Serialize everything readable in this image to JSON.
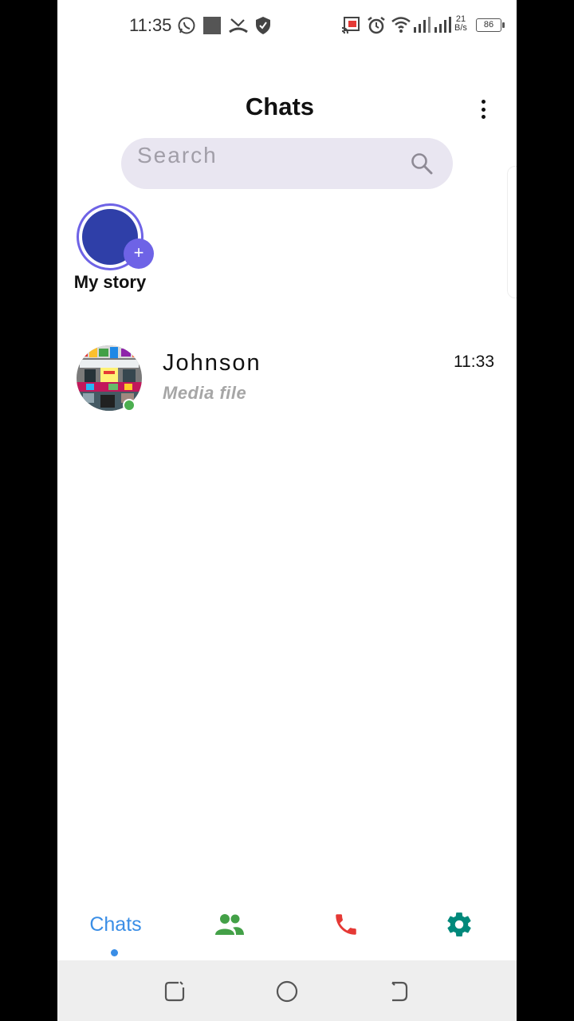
{
  "status_bar": {
    "time": "11:35",
    "net_speed_value": "21",
    "net_speed_unit": "B/s",
    "battery": "86"
  },
  "header": {
    "title": "Chats"
  },
  "search": {
    "placeholder": "Search"
  },
  "story": {
    "label": "My story",
    "add_symbol": "+"
  },
  "chats": [
    {
      "name": "Johnson",
      "preview": "Media file",
      "time": "11:33",
      "online": true
    }
  ],
  "bottom_nav": {
    "chats_label": "Chats",
    "icons": [
      "people-icon",
      "phone-icon",
      "settings-gear-icon"
    ]
  },
  "colors": {
    "accent": "#6e63e6",
    "story_avatar": "#2f3fa8",
    "nav_active": "#3a8ee6",
    "people_icon": "#43a047",
    "phone_icon": "#e53935",
    "settings_icon": "#00897b",
    "online": "#4caf50",
    "search_bg": "#e9e6f1"
  }
}
